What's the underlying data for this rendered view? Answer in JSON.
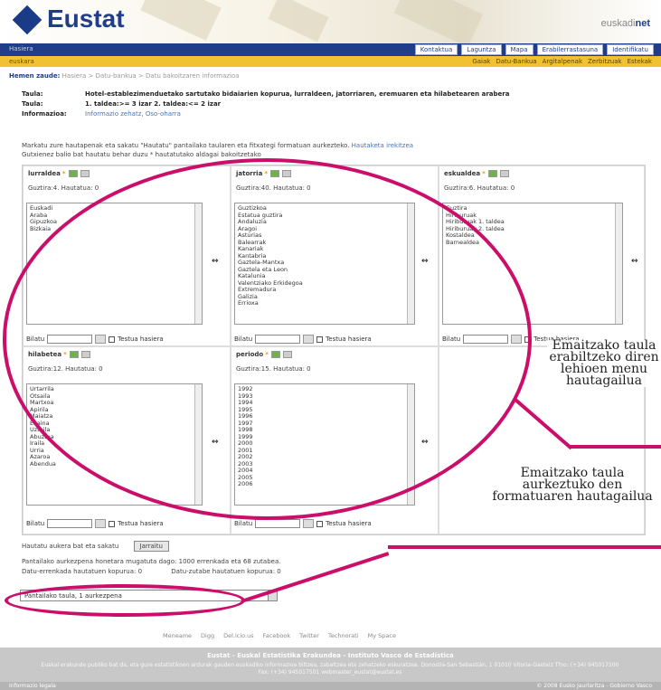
{
  "header": {
    "logo": "Eustat",
    "net_logo_prefix": "euskadi",
    "net_logo_suffix": "net"
  },
  "topnav": {
    "home": "Hasiera",
    "links": [
      "Kontaktua",
      "Laguntza",
      "Mapa",
      "Erabilerrastasuna",
      "Identifikatu"
    ]
  },
  "yellowbar": {
    "lang": "euskara",
    "links": [
      "Gaiak",
      "Datu-Bankua",
      "Argitalpenak",
      "Zerbitzuak",
      "Estekak"
    ]
  },
  "breadcrumb": {
    "label": "Hemen zaude:",
    "path": "Hasiera > Datu-bankua > Datu bakoitzaren informazioa"
  },
  "info": {
    "rows": [
      {
        "k": "Taula:",
        "v": "Hotel-establezimenduetako sartutako bidaiarien kopurua, lurraldeen, jatorriaren, eremuaren eta hilabetearen arabera"
      },
      {
        "k": "Taula:",
        "v": "1. taldea:>= 3 izar 2. taldea:<= 2 izar"
      },
      {
        "k": "Informazioa:",
        "v": "Informazio zehatz, Oso-oharra"
      }
    ]
  },
  "instructions": {
    "line1": "Markatu zure hautapenak eta sakatu \"Hautatu\" pantailako taularen eta fitxategi formatuan aurkezteko.",
    "line1_link": "Hautaketa irekitzea",
    "line2": "Gutxienez balio bat hautatu behar duzu * hautatutako aldagai bakoitzetako"
  },
  "panels": [
    {
      "title": "lurraldea",
      "count": "Guztira:4. Hautatua: 0",
      "items": [
        "Euskadi",
        "Araba",
        "Gipuzkoa",
        "Bizkaia"
      ]
    },
    {
      "title": "jatorria",
      "count": "Guztira:40. Hautatua: 0",
      "items": [
        "Guztizkoa",
        "Estatua guztira",
        "Andaluzia",
        "Aragoi",
        "Asturias",
        "Balearrak",
        "Kanariak",
        "Kantabria",
        "Gaztela-Mantxa",
        "Gaztela eta Leon",
        "Katalunia",
        "Valentziako Erkidegoa",
        "Extremadura",
        "Galizia",
        "Errioxa"
      ]
    },
    {
      "title": "eskualdea",
      "count": "Guztira:6. Hautatua: 0",
      "items": [
        "Guztira",
        "Hiriburuak",
        "Hiriburuak 1. taldea",
        "Hiriburuak 2. taldea",
        "Kostaldea",
        "Barnealdea"
      ]
    },
    {
      "title": "hilabetea",
      "count": "Guztira:12. Hautatua: 0",
      "items": [
        "Urtarrila",
        "Otsaila",
        "Martxoa",
        "Apirila",
        "Maiatza",
        "Ekaina",
        "Uztaila",
        "Abuztua",
        "Iraila",
        "Urria",
        "Azaroa",
        "Abendua"
      ]
    },
    {
      "title": "periodo",
      "count": "Guztira:15. Hautatua: 0",
      "items": [
        "1992",
        "1993",
        "1994",
        "1995",
        "1996",
        "1997",
        "1998",
        "1999",
        "2000",
        "2001",
        "2002",
        "2003",
        "2004",
        "2005",
        "2006"
      ]
    }
  ],
  "search": {
    "label": "Bilatu",
    "checkbox": "Testua hasiera"
  },
  "actions": {
    "send_text": "Hautatu aukera bat eta sakatu",
    "send_button": "Jarraitu",
    "limit_text": "Pantailako aurkezpena honetara mugatuta dago: 1000 errenkada eta 68 zutabea.",
    "rows_count": "Datu-errenkada hautatuen kopurua: 0",
    "cols_count": "Datu-zutabe hautatuen kopurua: 0",
    "select_value": "Pantailako taula, 1 aurkezpena"
  },
  "share": [
    "Meneame",
    "Digg",
    "Del.icio.us",
    "Facebook",
    "Twitter",
    "Technorati",
    "My Space"
  ],
  "footer": {
    "title": "Eustat - Euskal Estatistika Erakundea - Instituto Vasco de Estadística",
    "text": "Euskal erakunde publiko bat da, eta gure estatistikoen ardurak gauden euskadiko informazioa biltzea, zabaltzea eta zehatzeko eskuratzea. Donostia-San Sebastián, 1 01010 Vitoria-Gasteiz Tfno: (+34) 945017500 Fax: (+34) 945017501 webmaster_eustat@eustat.es",
    "left": "Informazio legala",
    "right": "© 2008 Eusko Jaurlaritza - Gobierno Vasco"
  },
  "annotations": {
    "right_top": "Emaitzako taula erabiltzeko diren lehioen menu hautagailua",
    "right_bottom": "Emaitzako taula aurkeztuko den formatuaren hautagailua"
  },
  "colors": {
    "brand": "#1f3d88",
    "accent": "#f0c232",
    "annotation": "#cc0e6b"
  }
}
